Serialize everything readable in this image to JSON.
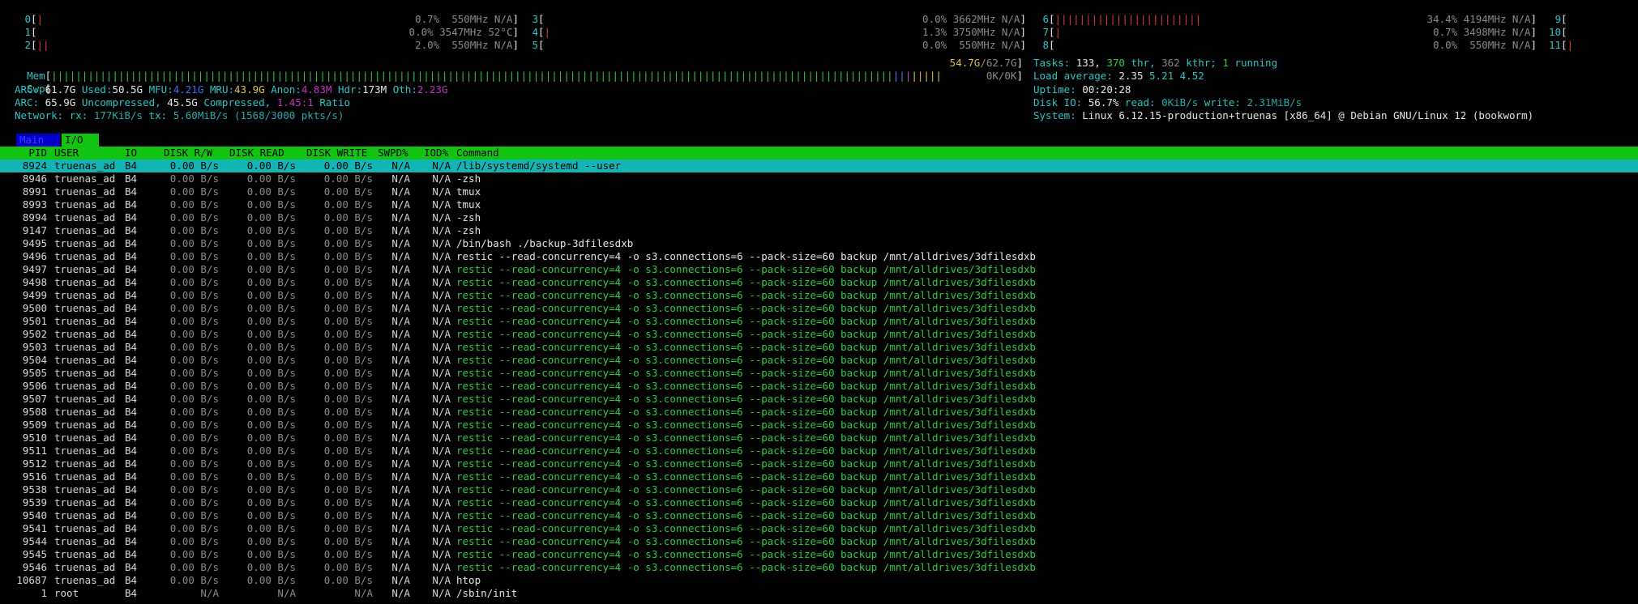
{
  "cpus_left": [
    {
      "idx": "0",
      "bar": "|",
      "val": "0.7%  550MHz N/A"
    },
    {
      "idx": "1",
      "bar": "",
      "val": "0.0% 3547MHz 52°C"
    },
    {
      "idx": "2",
      "bar": "||",
      "val": "2.0%  550MHz N/A"
    }
  ],
  "cpus_mid": [
    {
      "idx": "3",
      "bar": "",
      "val": "0.0% 3662MHz N/A"
    },
    {
      "idx": "4",
      "bar": "|",
      "val": "1.3% 3750MHz N/A"
    },
    {
      "idx": "5",
      "bar": "",
      "val": "0.0%  550MHz N/A"
    }
  ],
  "cpus_right": [
    {
      "idx": "6",
      "bar": "||||||||||||||||||||||||",
      "val": "34.4% 4194MHz N/A"
    },
    {
      "idx": "7",
      "bar": "|",
      "val": "0.7% 3498MHz N/A"
    },
    {
      "idx": "8",
      "bar": "",
      "val": "0.0%  550MHz N/A"
    }
  ],
  "cpus_far": [
    {
      "idx": "9",
      "bar": "["
    },
    {
      "idx": "10",
      "bar": "["
    },
    {
      "idx": "11",
      "bar": "[|"
    }
  ],
  "mem": {
    "label": "Mem",
    "value": "54.7G",
    "total": "/62.7G"
  },
  "swp": {
    "label": "Swp",
    "value": "0K/0K"
  },
  "arc": {
    "label": "ARC:",
    "size": "61.7G",
    "used_label": "Used:",
    "used": "50.5G",
    "mfu_label": "MFU:",
    "mfu": "4.21G",
    "mru_label": "MRU:",
    "mru": "43.9G",
    "anon_label": "Anon:",
    "anon": "4.83M",
    "hdr_label": "Hdr:",
    "hdr": "173M",
    "oth_label": "Oth:",
    "oth": "2.23G"
  },
  "arc2": {
    "label": "ARC:",
    "uncompressed": "65.9G",
    "uncompressed_label": "Uncompressed,",
    "compressed": "45.5G",
    "compressed_label": "Compressed,",
    "ratio": "1.45:1",
    "ratio_label": "Ratio"
  },
  "network": {
    "label": "Network:",
    "rx_label": "rx:",
    "rx": "177KiB/s",
    "tx_label": "tx:",
    "tx": "5.60MiB/s",
    "pkts": "(1568/3000 pkts/s)"
  },
  "tasks": {
    "label": "Tasks:",
    "tasks": "133,",
    "thr": "370",
    "thr_label": "thr,",
    "kthr": "362",
    "kthr_label": "kthr;",
    "running": "1",
    "running_label": "running"
  },
  "load": {
    "label": "Load average:",
    "l1": "2.35",
    "l5": "5.21",
    "l15": "4.52"
  },
  "uptime": {
    "label": "Uptime:",
    "value": "00:20:28"
  },
  "diskio": {
    "label": "Disk IO:",
    "pct": "56.7%",
    "read_label": "read:",
    "read": "0KiB/s",
    "write_label": "write:",
    "write": "2.31MiB/s"
  },
  "system": {
    "label": "System:",
    "value": "Linux 6.12.15-production+truenas [x86_64] @ Debian GNU/Linux 12 (bookworm)"
  },
  "tabs": {
    "main": "Main",
    "io": "I/O"
  },
  "header": {
    "pid": "PID",
    "user": "USER",
    "io": "IO",
    "disk_rw": "DISK R/W",
    "disk_read": "DISK READ",
    "disk_write": "DISK WRITE",
    "swpd": "SWPD%",
    "iod": "IOD%",
    "command": "Command"
  },
  "rows": [
    {
      "pid": "8924",
      "user": "truenas_ad",
      "io": "B4",
      "rw": "0.00 B/s",
      "rd": "0.00 B/s",
      "wr": "0.00 B/s",
      "swpd": "N/A",
      "iod": "N/A",
      "cmd": "/lib/systemd/systemd --user",
      "green": false
    },
    {
      "pid": "8946",
      "user": "truenas_ad",
      "io": "B4",
      "rw": "0.00 B/s",
      "rd": "0.00 B/s",
      "wr": "0.00 B/s",
      "swpd": "N/A",
      "iod": "N/A",
      "cmd": "-zsh",
      "green": false
    },
    {
      "pid": "8991",
      "user": "truenas_ad",
      "io": "B4",
      "rw": "0.00 B/s",
      "rd": "0.00 B/s",
      "wr": "0.00 B/s",
      "swpd": "N/A",
      "iod": "N/A",
      "cmd": "tmux",
      "green": false
    },
    {
      "pid": "8993",
      "user": "truenas_ad",
      "io": "B4",
      "rw": "0.00 B/s",
      "rd": "0.00 B/s",
      "wr": "0.00 B/s",
      "swpd": "N/A",
      "iod": "N/A",
      "cmd": "tmux",
      "green": false
    },
    {
      "pid": "8994",
      "user": "truenas_ad",
      "io": "B4",
      "rw": "0.00 B/s",
      "rd": "0.00 B/s",
      "wr": "0.00 B/s",
      "swpd": "N/A",
      "iod": "N/A",
      "cmd": "-zsh",
      "green": false
    },
    {
      "pid": "9147",
      "user": "truenas_ad",
      "io": "B4",
      "rw": "0.00 B/s",
      "rd": "0.00 B/s",
      "wr": "0.00 B/s",
      "swpd": "N/A",
      "iod": "N/A",
      "cmd": "-zsh",
      "green": false
    },
    {
      "pid": "9495",
      "user": "truenas_ad",
      "io": "B4",
      "rw": "0.00 B/s",
      "rd": "0.00 B/s",
      "wr": "0.00 B/s",
      "swpd": "N/A",
      "iod": "N/A",
      "cmd": "/bin/bash ./backup-3dfilesdxb",
      "green": false
    },
    {
      "pid": "9496",
      "user": "truenas_ad",
      "io": "B4",
      "rw": "0.00 B/s",
      "rd": "0.00 B/s",
      "wr": "0.00 B/s",
      "swpd": "N/A",
      "iod": "N/A",
      "cmd": "restic --read-concurrency=4 -o s3.connections=6 --pack-size=60 backup /mnt/alldrives/3dfilesdxb",
      "green": false
    },
    {
      "pid": "9497",
      "user": "truenas_ad",
      "io": "B4",
      "rw": "0.00 B/s",
      "rd": "0.00 B/s",
      "wr": "0.00 B/s",
      "swpd": "N/A",
      "iod": "N/A",
      "cmd": "restic --read-concurrency=4 -o s3.connections=6 --pack-size=60 backup /mnt/alldrives/3dfilesdxb",
      "green": true
    },
    {
      "pid": "9498",
      "user": "truenas_ad",
      "io": "B4",
      "rw": "0.00 B/s",
      "rd": "0.00 B/s",
      "wr": "0.00 B/s",
      "swpd": "N/A",
      "iod": "N/A",
      "cmd": "restic --read-concurrency=4 -o s3.connections=6 --pack-size=60 backup /mnt/alldrives/3dfilesdxb",
      "green": true
    },
    {
      "pid": "9499",
      "user": "truenas_ad",
      "io": "B4",
      "rw": "0.00 B/s",
      "rd": "0.00 B/s",
      "wr": "0.00 B/s",
      "swpd": "N/A",
      "iod": "N/A",
      "cmd": "restic --read-concurrency=4 -o s3.connections=6 --pack-size=60 backup /mnt/alldrives/3dfilesdxb",
      "green": true
    },
    {
      "pid": "9500",
      "user": "truenas_ad",
      "io": "B4",
      "rw": "0.00 B/s",
      "rd": "0.00 B/s",
      "wr": "0.00 B/s",
      "swpd": "N/A",
      "iod": "N/A",
      "cmd": "restic --read-concurrency=4 -o s3.connections=6 --pack-size=60 backup /mnt/alldrives/3dfilesdxb",
      "green": true
    },
    {
      "pid": "9501",
      "user": "truenas_ad",
      "io": "B4",
      "rw": "0.00 B/s",
      "rd": "0.00 B/s",
      "wr": "0.00 B/s",
      "swpd": "N/A",
      "iod": "N/A",
      "cmd": "restic --read-concurrency=4 -o s3.connections=6 --pack-size=60 backup /mnt/alldrives/3dfilesdxb",
      "green": true
    },
    {
      "pid": "9502",
      "user": "truenas_ad",
      "io": "B4",
      "rw": "0.00 B/s",
      "rd": "0.00 B/s",
      "wr": "0.00 B/s",
      "swpd": "N/A",
      "iod": "N/A",
      "cmd": "restic --read-concurrency=4 -o s3.connections=6 --pack-size=60 backup /mnt/alldrives/3dfilesdxb",
      "green": true
    },
    {
      "pid": "9503",
      "user": "truenas_ad",
      "io": "B4",
      "rw": "0.00 B/s",
      "rd": "0.00 B/s",
      "wr": "0.00 B/s",
      "swpd": "N/A",
      "iod": "N/A",
      "cmd": "restic --read-concurrency=4 -o s3.connections=6 --pack-size=60 backup /mnt/alldrives/3dfilesdxb",
      "green": true
    },
    {
      "pid": "9504",
      "user": "truenas_ad",
      "io": "B4",
      "rw": "0.00 B/s",
      "rd": "0.00 B/s",
      "wr": "0.00 B/s",
      "swpd": "N/A",
      "iod": "N/A",
      "cmd": "restic --read-concurrency=4 -o s3.connections=6 --pack-size=60 backup /mnt/alldrives/3dfilesdxb",
      "green": true
    },
    {
      "pid": "9505",
      "user": "truenas_ad",
      "io": "B4",
      "rw": "0.00 B/s",
      "rd": "0.00 B/s",
      "wr": "0.00 B/s",
      "swpd": "N/A",
      "iod": "N/A",
      "cmd": "restic --read-concurrency=4 -o s3.connections=6 --pack-size=60 backup /mnt/alldrives/3dfilesdxb",
      "green": true
    },
    {
      "pid": "9506",
      "user": "truenas_ad",
      "io": "B4",
      "rw": "0.00 B/s",
      "rd": "0.00 B/s",
      "wr": "0.00 B/s",
      "swpd": "N/A",
      "iod": "N/A",
      "cmd": "restic --read-concurrency=4 -o s3.connections=6 --pack-size=60 backup /mnt/alldrives/3dfilesdxb",
      "green": true
    },
    {
      "pid": "9507",
      "user": "truenas_ad",
      "io": "B4",
      "rw": "0.00 B/s",
      "rd": "0.00 B/s",
      "wr": "0.00 B/s",
      "swpd": "N/A",
      "iod": "N/A",
      "cmd": "restic --read-concurrency=4 -o s3.connections=6 --pack-size=60 backup /mnt/alldrives/3dfilesdxb",
      "green": true
    },
    {
      "pid": "9508",
      "user": "truenas_ad",
      "io": "B4",
      "rw": "0.00 B/s",
      "rd": "0.00 B/s",
      "wr": "0.00 B/s",
      "swpd": "N/A",
      "iod": "N/A",
      "cmd": "restic --read-concurrency=4 -o s3.connections=6 --pack-size=60 backup /mnt/alldrives/3dfilesdxb",
      "green": true
    },
    {
      "pid": "9509",
      "user": "truenas_ad",
      "io": "B4",
      "rw": "0.00 B/s",
      "rd": "0.00 B/s",
      "wr": "0.00 B/s",
      "swpd": "N/A",
      "iod": "N/A",
      "cmd": "restic --read-concurrency=4 -o s3.connections=6 --pack-size=60 backup /mnt/alldrives/3dfilesdxb",
      "green": true
    },
    {
      "pid": "9510",
      "user": "truenas_ad",
      "io": "B4",
      "rw": "0.00 B/s",
      "rd": "0.00 B/s",
      "wr": "0.00 B/s",
      "swpd": "N/A",
      "iod": "N/A",
      "cmd": "restic --read-concurrency=4 -o s3.connections=6 --pack-size=60 backup /mnt/alldrives/3dfilesdxb",
      "green": true
    },
    {
      "pid": "9511",
      "user": "truenas_ad",
      "io": "B4",
      "rw": "0.00 B/s",
      "rd": "0.00 B/s",
      "wr": "0.00 B/s",
      "swpd": "N/A",
      "iod": "N/A",
      "cmd": "restic --read-concurrency=4 -o s3.connections=6 --pack-size=60 backup /mnt/alldrives/3dfilesdxb",
      "green": true
    },
    {
      "pid": "9512",
      "user": "truenas_ad",
      "io": "B4",
      "rw": "0.00 B/s",
      "rd": "0.00 B/s",
      "wr": "0.00 B/s",
      "swpd": "N/A",
      "iod": "N/A",
      "cmd": "restic --read-concurrency=4 -o s3.connections=6 --pack-size=60 backup /mnt/alldrives/3dfilesdxb",
      "green": true
    },
    {
      "pid": "9516",
      "user": "truenas_ad",
      "io": "B4",
      "rw": "0.00 B/s",
      "rd": "0.00 B/s",
      "wr": "0.00 B/s",
      "swpd": "N/A",
      "iod": "N/A",
      "cmd": "restic --read-concurrency=4 -o s3.connections=6 --pack-size=60 backup /mnt/alldrives/3dfilesdxb",
      "green": true
    },
    {
      "pid": "9538",
      "user": "truenas_ad",
      "io": "B4",
      "rw": "0.00 B/s",
      "rd": "0.00 B/s",
      "wr": "0.00 B/s",
      "swpd": "N/A",
      "iod": "N/A",
      "cmd": "restic --read-concurrency=4 -o s3.connections=6 --pack-size=60 backup /mnt/alldrives/3dfilesdxb",
      "green": true
    },
    {
      "pid": "9539",
      "user": "truenas_ad",
      "io": "B4",
      "rw": "0.00 B/s",
      "rd": "0.00 B/s",
      "wr": "0.00 B/s",
      "swpd": "N/A",
      "iod": "N/A",
      "cmd": "restic --read-concurrency=4 -o s3.connections=6 --pack-size=60 backup /mnt/alldrives/3dfilesdxb",
      "green": true
    },
    {
      "pid": "9540",
      "user": "truenas_ad",
      "io": "B4",
      "rw": "0.00 B/s",
      "rd": "0.00 B/s",
      "wr": "0.00 B/s",
      "swpd": "N/A",
      "iod": "N/A",
      "cmd": "restic --read-concurrency=4 -o s3.connections=6 --pack-size=60 backup /mnt/alldrives/3dfilesdxb",
      "green": true
    },
    {
      "pid": "9541",
      "user": "truenas_ad",
      "io": "B4",
      "rw": "0.00 B/s",
      "rd": "0.00 B/s",
      "wr": "0.00 B/s",
      "swpd": "N/A",
      "iod": "N/A",
      "cmd": "restic --read-concurrency=4 -o s3.connections=6 --pack-size=60 backup /mnt/alldrives/3dfilesdxb",
      "green": true
    },
    {
      "pid": "9544",
      "user": "truenas_ad",
      "io": "B4",
      "rw": "0.00 B/s",
      "rd": "0.00 B/s",
      "wr": "0.00 B/s",
      "swpd": "N/A",
      "iod": "N/A",
      "cmd": "restic --read-concurrency=4 -o s3.connections=6 --pack-size=60 backup /mnt/alldrives/3dfilesdxb",
      "green": true
    },
    {
      "pid": "9545",
      "user": "truenas_ad",
      "io": "B4",
      "rw": "0.00 B/s",
      "rd": "0.00 B/s",
      "wr": "0.00 B/s",
      "swpd": "N/A",
      "iod": "N/A",
      "cmd": "restic --read-concurrency=4 -o s3.connections=6 --pack-size=60 backup /mnt/alldrives/3dfilesdxb",
      "green": true
    },
    {
      "pid": "9546",
      "user": "truenas_ad",
      "io": "B4",
      "rw": "0.00 B/s",
      "rd": "0.00 B/s",
      "wr": "0.00 B/s",
      "swpd": "N/A",
      "iod": "N/A",
      "cmd": "restic --read-concurrency=4 -o s3.connections=6 --pack-size=60 backup /mnt/alldrives/3dfilesdxb",
      "green": true
    },
    {
      "pid": "10687",
      "user": "truenas_ad",
      "io": "B4",
      "rw": "0.00 B/s",
      "rd": "0.00 B/s",
      "wr": "0.00 B/s",
      "swpd": "N/A",
      "iod": "N/A",
      "cmd": "htop",
      "green": false
    },
    {
      "pid": "1",
      "user": "root",
      "io": "B4",
      "rw": "N/A",
      "rd": "N/A",
      "wr": "N/A",
      "swpd": "N/A",
      "iod": "N/A",
      "cmd": "/sbin/init",
      "green": false
    }
  ]
}
